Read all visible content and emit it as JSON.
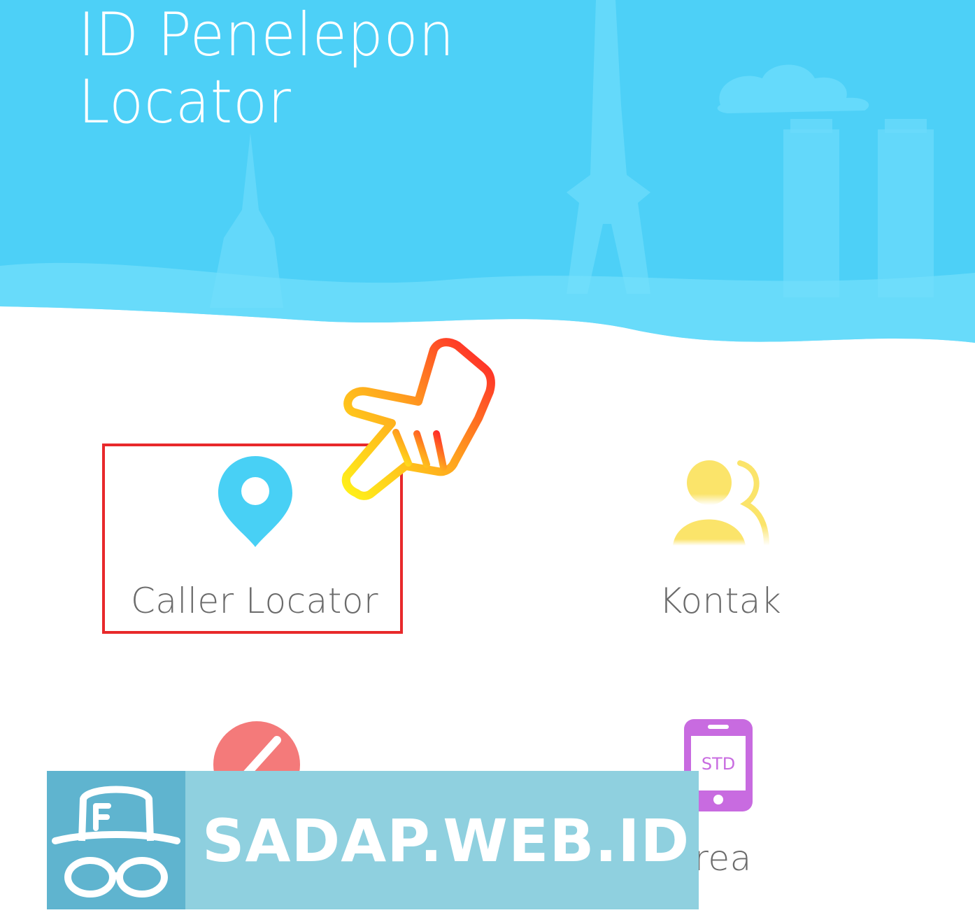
{
  "app": {
    "title_line1": "ID Penelepon",
    "title_line2": "Locator"
  },
  "menu": {
    "caller_locator": {
      "label": "Caller Locator",
      "icon": "location-pin-icon",
      "color": "#48d0f5"
    },
    "kontak": {
      "label": "Kontak",
      "icon": "contacts-icon",
      "color": "#fbe46a"
    },
    "block": {
      "label": "",
      "icon": "block-icon",
      "color": "#f47a7a"
    },
    "std_code": {
      "label": "e Area",
      "icon": "std-phone-icon",
      "icon_text": "STD",
      "color": "#c86be0"
    }
  },
  "overlay": {
    "highlight_color": "#e8292b",
    "pointer_icon": "pointing-hand-icon"
  },
  "watermark": {
    "text": "SADAP.WEB.ID",
    "icon": "spy-hat-glasses-icon"
  },
  "colors": {
    "header_bg": "#4dd0f7",
    "label_text": "#6b6b6b"
  }
}
